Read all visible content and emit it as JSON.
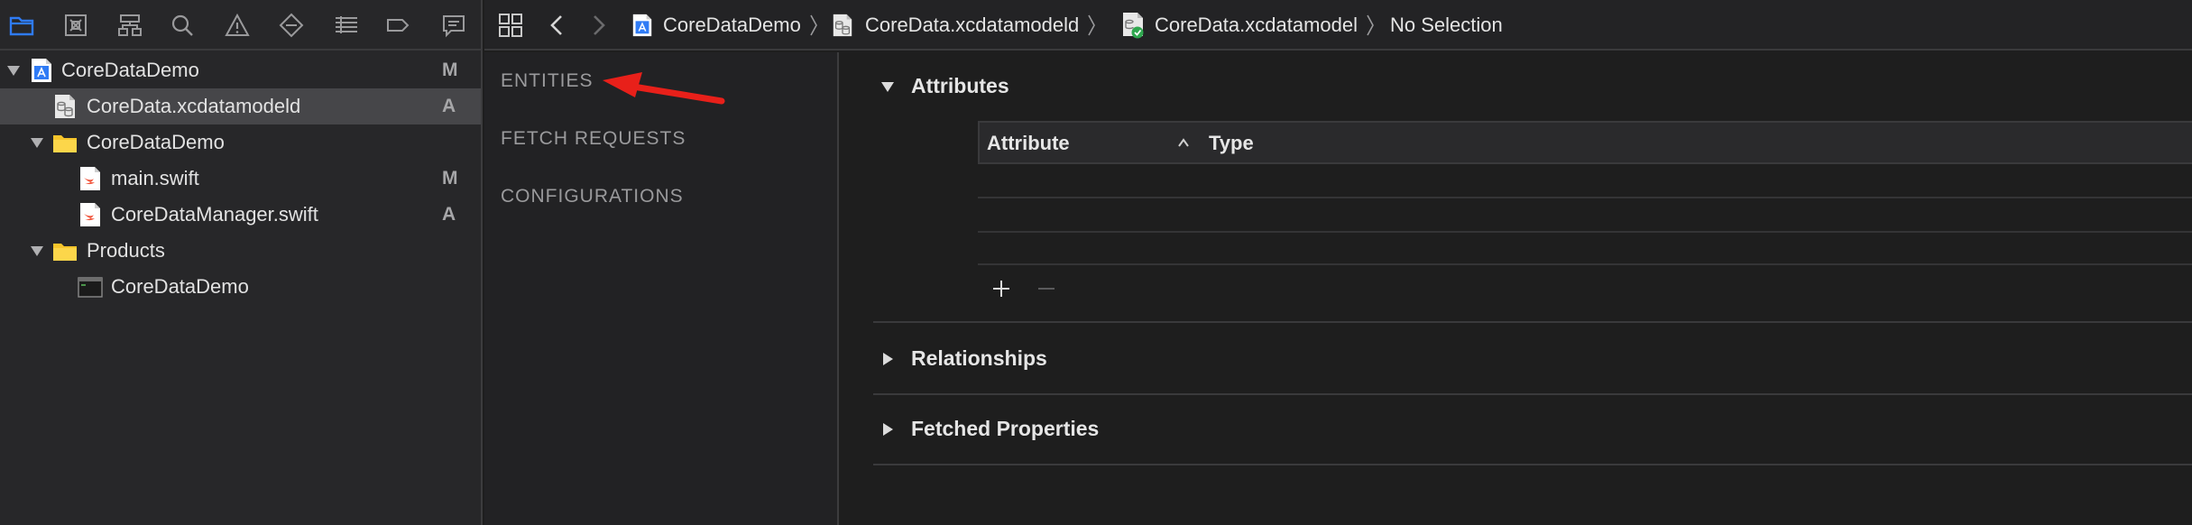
{
  "navigator": {
    "toolbar_icons": [
      "folder-icon",
      "source-control-icon",
      "hierarchy-icon",
      "find-icon",
      "issue-warning-icon",
      "test-diamond-icon",
      "debug-list-icon",
      "breakpoint-icon",
      "report-icon"
    ],
    "tree": [
      {
        "label": "CoreDataDemo",
        "badge": "M",
        "icon": "xcode-project-icon",
        "level": 0,
        "expanded": true
      },
      {
        "label": "CoreData.xcdatamodeld",
        "badge": "A",
        "icon": "data-model-icon",
        "level": 1,
        "selected": true
      },
      {
        "label": "CoreDataDemo",
        "badge": "",
        "icon": "folder-icon",
        "level": 1,
        "expanded": true
      },
      {
        "label": "main.swift",
        "badge": "M",
        "icon": "swift-file-icon",
        "level": 2
      },
      {
        "label": "CoreDataManager.swift",
        "badge": "A",
        "icon": "swift-file-icon",
        "level": 2
      },
      {
        "label": "Products",
        "badge": "",
        "icon": "folder-icon",
        "level": 1,
        "expanded": true
      },
      {
        "label": "CoreDataDemo",
        "badge": "",
        "icon": "executable-icon",
        "level": 2
      }
    ]
  },
  "jumpbar": {
    "crumbs": [
      "CoreDataDemo",
      "CoreData.xcdatamodeld",
      "CoreData.xcdatamodel",
      "No Selection"
    ]
  },
  "outline": {
    "sections": [
      "ENTITIES",
      "FETCH REQUESTS",
      "CONFIGURATIONS"
    ]
  },
  "editor": {
    "attributes_title": "Attributes",
    "columns": [
      "Attribute",
      "Type"
    ],
    "relationships_title": "Relationships",
    "fetched_title": "Fetched Properties"
  },
  "colors": {
    "accent_blue": "#2f7bf5",
    "annotation_red": "#e8201a",
    "folder_yellow": "#f7c52b"
  }
}
